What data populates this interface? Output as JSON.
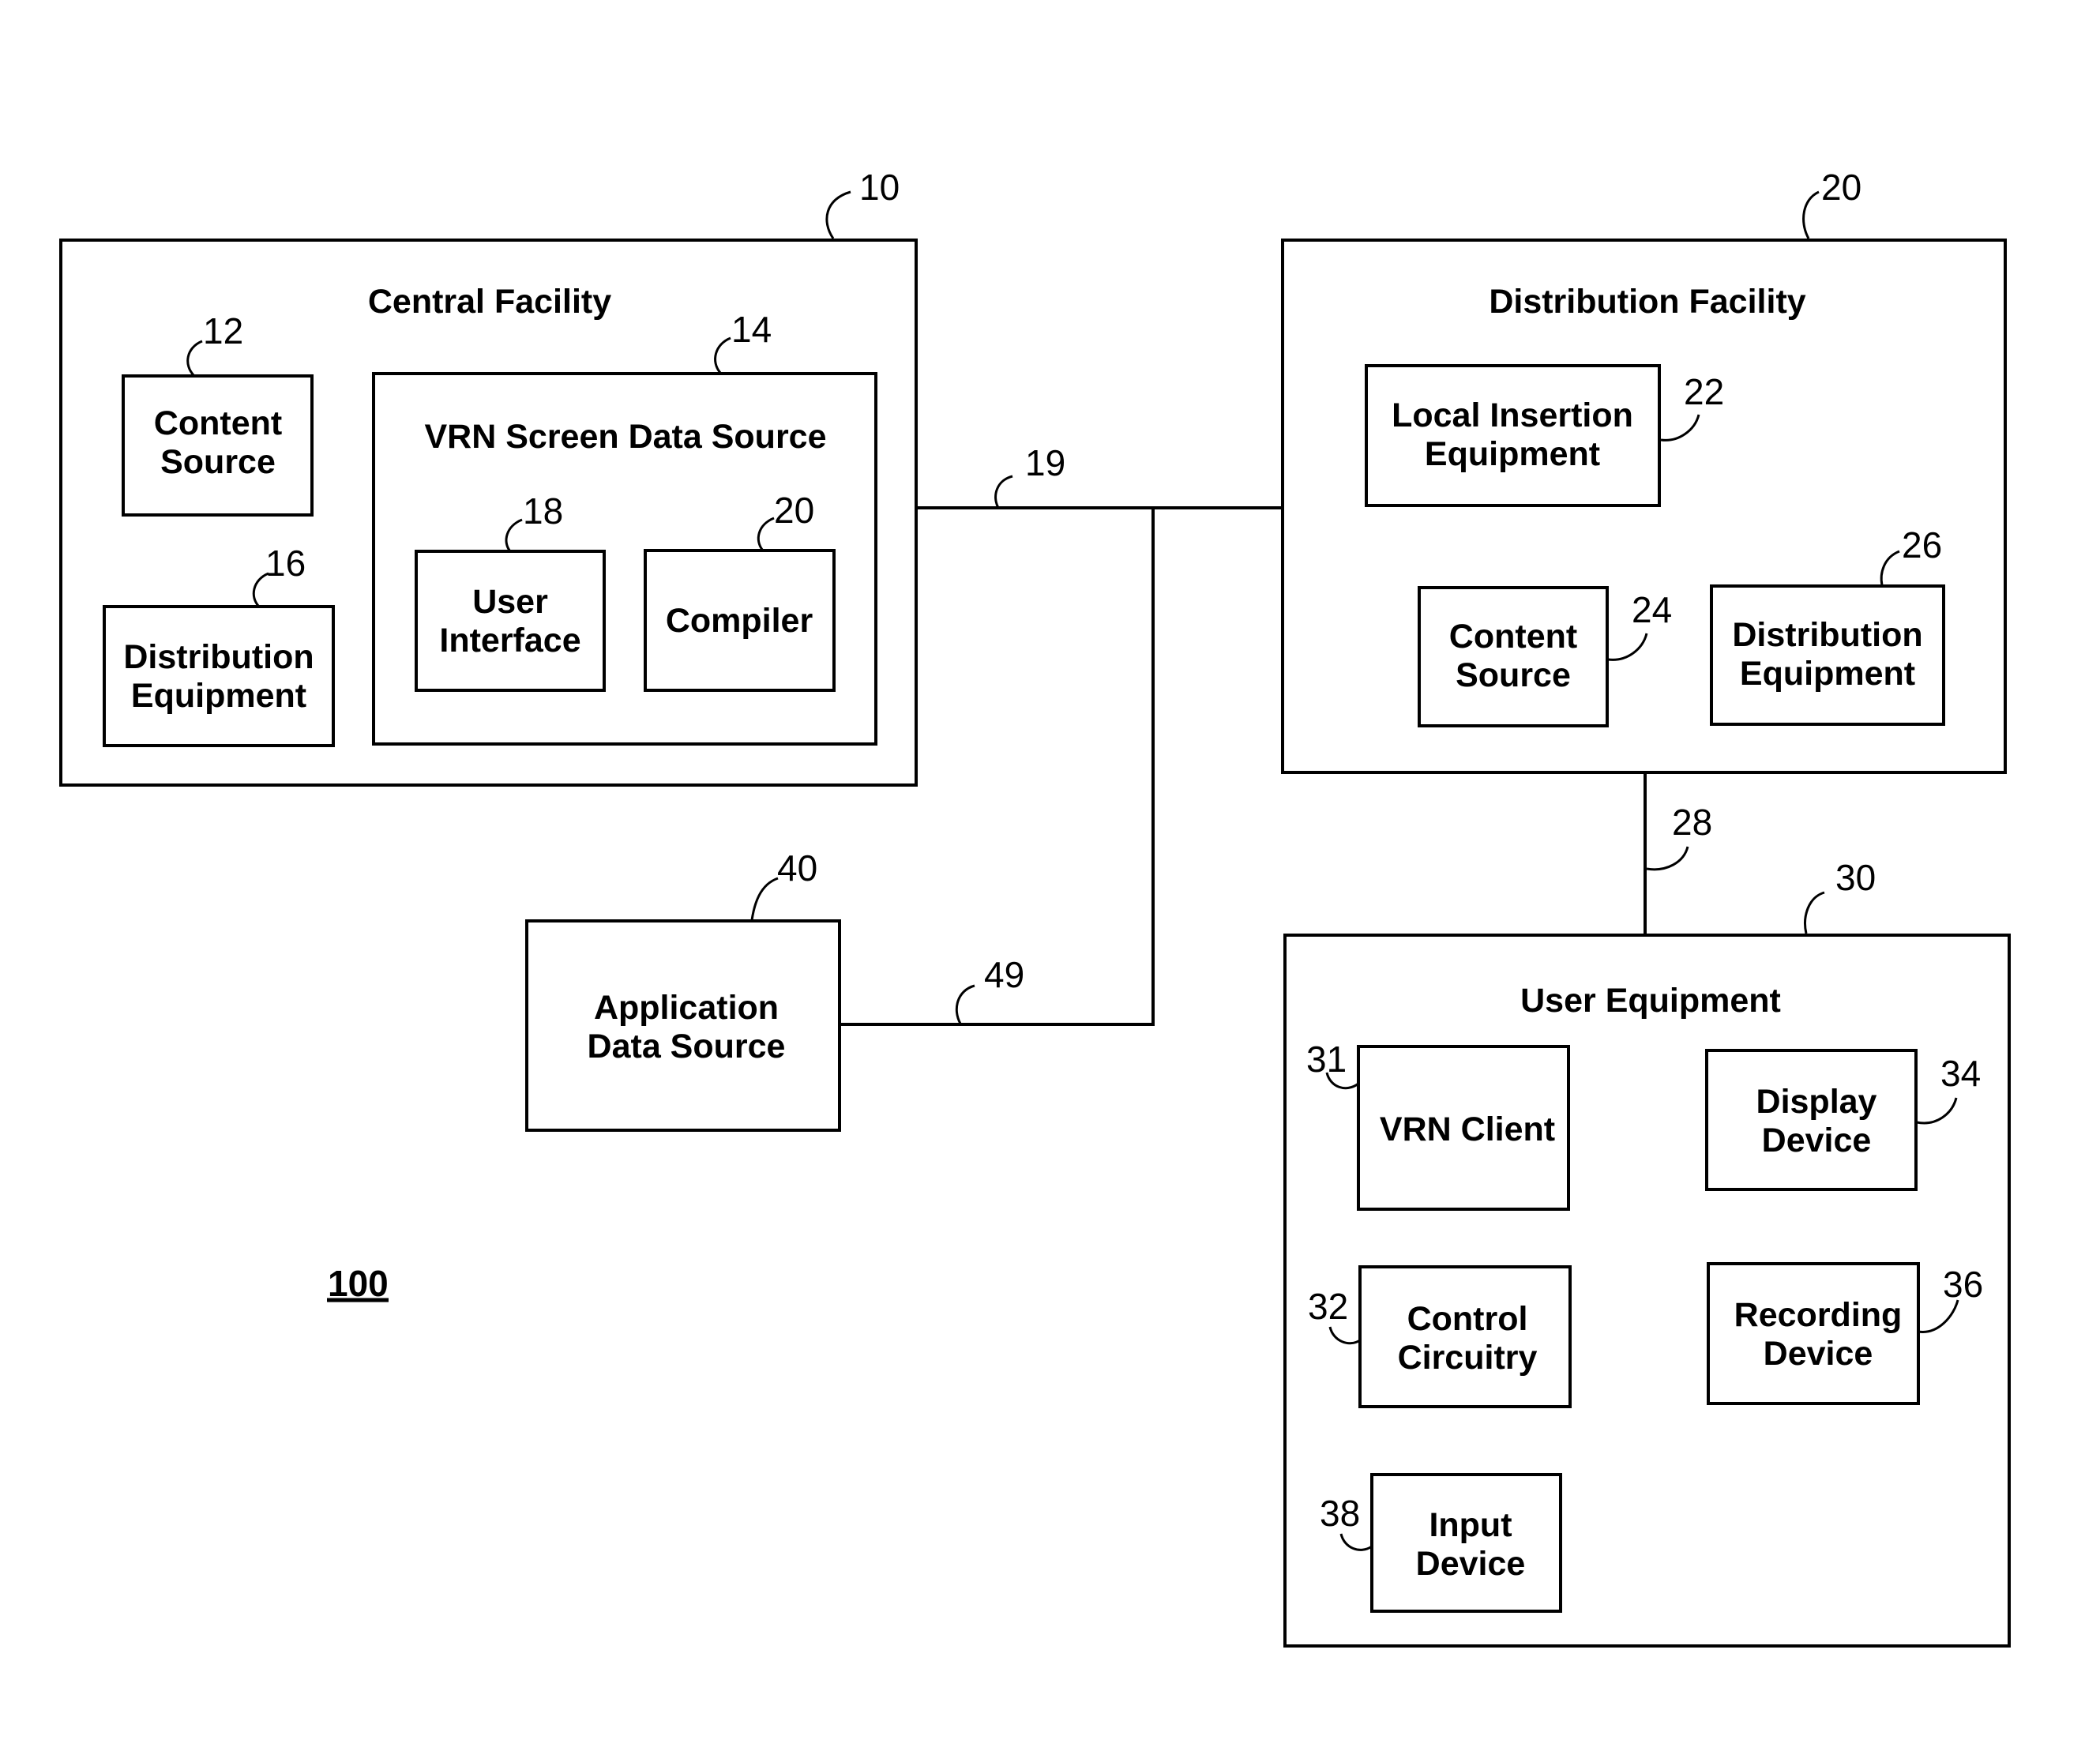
{
  "figure_number": "100",
  "connections": {
    "link_19": "19",
    "link_28": "28",
    "link_49": "49"
  },
  "central_facility": {
    "ref": "10",
    "title": "Central Facility",
    "content_source": {
      "ref": "12",
      "lines": [
        "Content",
        "Source"
      ]
    },
    "distribution_equipment": {
      "ref": "16",
      "lines": [
        "Distribution",
        "Equipment"
      ]
    },
    "vrn_screen_data_source": {
      "ref": "14",
      "title": "VRN Screen Data Source",
      "user_interface": {
        "ref": "18",
        "lines": [
          "User",
          "Interface"
        ]
      },
      "compiler": {
        "ref": "20",
        "lines": [
          "Compiler"
        ]
      }
    }
  },
  "distribution_facility": {
    "ref": "20",
    "title": "Distribution Facility",
    "local_insertion_equipment": {
      "ref": "22",
      "lines": [
        "Local Insertion",
        "Equipment"
      ]
    },
    "content_source": {
      "ref": "24",
      "lines": [
        "Content",
        "Source"
      ]
    },
    "distribution_equipment": {
      "ref": "26",
      "lines": [
        "Distribution",
        "Equipment"
      ]
    }
  },
  "application_data_source": {
    "ref": "40",
    "lines": [
      "Application",
      "Data Source"
    ]
  },
  "user_equipment": {
    "ref": "30",
    "title": "User Equipment",
    "vrn_client": {
      "ref": "31",
      "lines": [
        "VRN Client"
      ]
    },
    "control_circuitry": {
      "ref": "32",
      "lines": [
        "Control",
        "Circuitry"
      ]
    },
    "display_device": {
      "ref": "34",
      "lines": [
        "Display",
        "Device"
      ]
    },
    "recording_device": {
      "ref": "36",
      "lines": [
        "Recording",
        "Device"
      ]
    },
    "input_device": {
      "ref": "38",
      "lines": [
        "Input",
        "Device"
      ]
    }
  }
}
